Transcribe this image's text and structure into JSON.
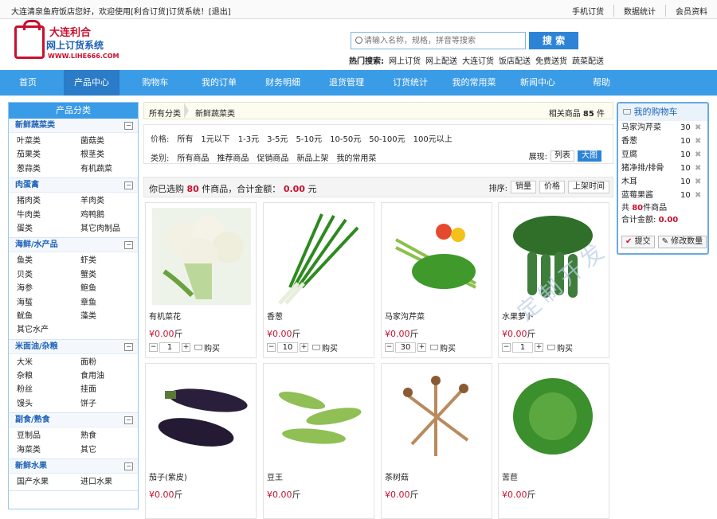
{
  "topbar": {
    "greeting": "大连清泉鱼府饭店您好，欢迎使用[利合订货]订货系统！[退出]",
    "links": [
      "手机订货",
      "数据统计",
      "会员资料"
    ]
  },
  "logo": {
    "line1": "大连利合",
    "line2": "网上订货系统",
    "line3": "WWW.LIHE666.COM"
  },
  "search": {
    "placeholder": "请输入名称，规格，拼音等搜索",
    "button": "搜 索",
    "hot_label": "热门搜索:",
    "hot": [
      "网上订货",
      "网上配送",
      "大连订货",
      "饭店配送",
      "免费送货",
      "蔬菜配送"
    ]
  },
  "nav": [
    "首页",
    "产品中心",
    "购物车",
    "我的订单",
    "财务明细",
    "退货管理",
    "订货统计",
    "我的常用菜",
    "新闻中心",
    "帮助"
  ],
  "sidebar": {
    "title": "产品分类",
    "categories": [
      {
        "name": "新鲜蔬菜类",
        "items": [
          "叶菜类",
          "菌菇类",
          "茄果类",
          "根茎类",
          "葱蒜类",
          "有机蔬菜"
        ]
      },
      {
        "name": "肉蛋禽",
        "items": [
          "猪肉类",
          "羊肉类",
          "牛肉类",
          "鸡鸭鹅",
          "蛋类",
          "其它肉制品"
        ]
      },
      {
        "name": "海鲜/水产品",
        "items": [
          "鱼类",
          "虾类",
          "贝类",
          "蟹类",
          "海参",
          "鲍鱼",
          "海蜇",
          "章鱼",
          "鱿鱼",
          "藻类",
          "其它水产"
        ]
      },
      {
        "name": "米面油/杂粮",
        "items": [
          "大米",
          "面粉",
          "杂粮",
          "食用油",
          "粉丝",
          "挂面",
          "馒头",
          "饼子"
        ]
      },
      {
        "name": "副食/熟食",
        "items": [
          "豆制品",
          "熟食",
          "海菜类",
          "其它"
        ]
      },
      {
        "name": "新鲜水果",
        "items": [
          "国产水果",
          "进口水果"
        ]
      }
    ]
  },
  "crumb": {
    "root": "所有分类",
    "current": "新鲜蔬菜类",
    "count_prefix": "相关商品",
    "count": "85",
    "count_suffix": "件"
  },
  "filter": {
    "price_label": "价格:",
    "prices": [
      "所有",
      "1元以下",
      "1-3元",
      "3-5元",
      "5-10元",
      "10-50元",
      "50-100元",
      "100元以上"
    ],
    "type_label": "类别:",
    "types": [
      "所有商品",
      "推荐商品",
      "促销商品",
      "新品上架",
      "我的常用菜"
    ],
    "view_label": "展现:",
    "view_list": "列表",
    "view_grid": "大图"
  },
  "summary": {
    "prefix": "你已选购",
    "count": "80",
    "mid": "件商品，合计金额：",
    "amount": "0.00",
    "suffix": "元",
    "sort_label": "排序:",
    "sorts": [
      "销量",
      "价格",
      "上架时间"
    ]
  },
  "products": [
    {
      "name": "有机菜花",
      "price": "¥0.00",
      "unit": "斤",
      "qty": "1",
      "buy": "购买"
    },
    {
      "name": "香葱",
      "price": "¥0.00",
      "unit": "斤",
      "qty": "10",
      "buy": "购买"
    },
    {
      "name": "马家沟芹菜",
      "price": "¥0.00",
      "unit": "斤",
      "qty": "30",
      "buy": "购买"
    },
    {
      "name": "水果萝卜",
      "price": "¥0.00",
      "unit": "斤",
      "qty": "1",
      "buy": "购买"
    },
    {
      "name": "茄子(紫皮)",
      "price": "¥0.00",
      "unit": "斤",
      "qty": "",
      "buy": "购买"
    },
    {
      "name": "豆王",
      "price": "¥0.00",
      "unit": "斤",
      "qty": "",
      "buy": "购买"
    },
    {
      "name": "茶树菇",
      "price": "¥0.00",
      "unit": "斤",
      "qty": "",
      "buy": "购买"
    },
    {
      "name": "苦苣",
      "price": "¥0.00",
      "unit": "斤",
      "qty": "",
      "buy": "购买"
    }
  ],
  "cart": {
    "title": "我的购物车",
    "items": [
      {
        "name": "马家沟芹菜",
        "qty": "30"
      },
      {
        "name": "香葱",
        "qty": "10"
      },
      {
        "name": "豆腐",
        "qty": "10"
      },
      {
        "name": "猪净排/排骨",
        "qty": "10"
      },
      {
        "name": "木耳",
        "qty": "10"
      },
      {
        "name": "蓝莓果酱",
        "qty": "10"
      }
    ],
    "total_prefix": "共",
    "total_count": "80",
    "total_suffix": "件商品",
    "amount_label": "合计金额:",
    "amount": "0.00",
    "submit": "提交",
    "modify": "修改数量"
  },
  "watermark": "定制开发",
  "colors": {
    "accent": "#3a9be6",
    "price_red": "#c8102e",
    "logo_red": "#c8102e",
    "link_blue": "#1b60b8"
  }
}
